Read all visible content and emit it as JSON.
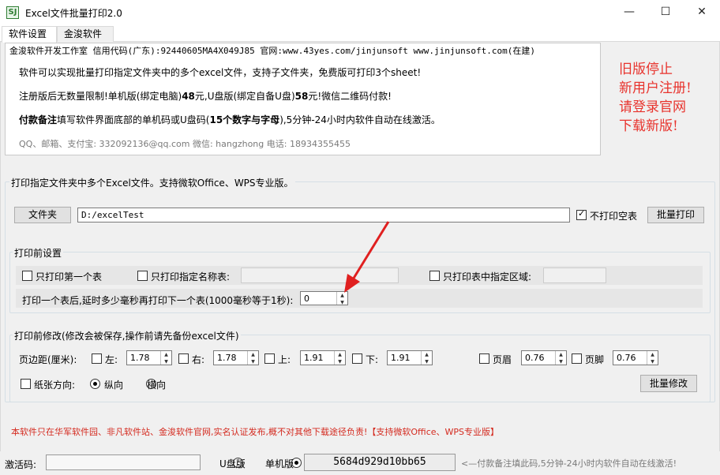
{
  "window": {
    "title": "Excel文件批量打印2.0",
    "icon_text": "SJ",
    "minimize_glyph": "—",
    "maximize_glyph": "☐",
    "close_glyph": "✕"
  },
  "tabs": [
    {
      "label": "软件设置",
      "active": true
    },
    {
      "label": "金浚软件",
      "active": false
    }
  ],
  "info": {
    "line1": "金浚软件开发工作室 信用代码(广东):92440605MA4X049J85 官网:www.43yes.com/jinjunsoft  www.jinjunsoft.com(在建)",
    "line2": "软件可以实现批量打印指定文件夹中的多个excel文件，支持子文件夹，免费版可打印3个sheet!",
    "line3_a": "注册版后无数量限制!单机版(绑定电脑)",
    "line3_b": "48",
    "line3_c": "元,U盘版(绑定自备U盘)",
    "line3_d": "58",
    "line3_e": "元!微信二维码付款!",
    "line4_a": "付款备注",
    "line4_b": "填写软件界面底部的单机码或U盘码(",
    "line4_c": "15个数字与字母",
    "line4_d": "),5分钟-24小时内软件自动在线激活。",
    "contact": "QQ、邮箱、支付宝: 332092136@qq.com    微信: hangzhong    电话: 18934355455",
    "notice": [
      "旧版停止",
      "新用户注册!",
      "请登录官网",
      "下载新版!"
    ]
  },
  "print_group": {
    "title": "打印指定文件夹中多个Excel文件。支持微软Office、WPS专业版。",
    "folder_button": "文件夹",
    "path_value": "D:/excelTest",
    "skip_empty_label": "不打印空表",
    "skip_empty_checked": true,
    "batch_print_button": "批量打印"
  },
  "pre_settings": {
    "title": "打印前设置",
    "first_sheet_label": "只打印第一个表",
    "named_sheet_label": "只打印指定名称表:",
    "named_sheet_value": "",
    "range_label": "只打印表中指定区域:",
    "range_value": "",
    "delay_label": "打印一个表后,延时多少毫秒再打印下一个表(1000毫秒等于1秒):",
    "delay_value": "0"
  },
  "modify": {
    "title": "打印前修改(修改会被保存,操作前请先备份excel文件)",
    "margin_label": "页边距(厘米):",
    "left_label": "左:",
    "left_value": "1.78",
    "right_label": "右:",
    "right_value": "1.78",
    "top_label": "上:",
    "top_value": "1.91",
    "bottom_label": "下:",
    "bottom_value": "1.91",
    "header_label": "页眉",
    "header_value": "0.76",
    "footer_label": "页脚",
    "footer_value": "0.76",
    "orientation_label": "纸张方向:",
    "portrait_label": "纵向",
    "landscape_label": "横向",
    "portrait_selected": true,
    "batch_modify_button": "批量修改"
  },
  "disclaimer": "本软件只在华军软件园、非凡软件站、金浚软件官网,实名认证发布,概不对其他下载途径负责!【支持微软Office、WPS专业版】",
  "status": {
    "activation_label": "激活码:",
    "activation_value": "",
    "usb_label": "U盘版",
    "single_label": "单机版",
    "single_selected": true,
    "machine_code": "5684d929d10bb65",
    "hint": "<—付款备注填此码,5分钟-24小时内软件自动在线激活!"
  },
  "colors": {
    "notice_red": "#e8332d",
    "disclaimer_red": "#d42a1f",
    "annotation_arrow": "#e02020"
  }
}
